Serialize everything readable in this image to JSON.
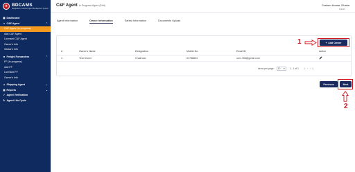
{
  "sidebar": {
    "logo": {
      "title": "BDCAMS",
      "subtitle": "Bangladesh Customs Agent Management System"
    },
    "items": [
      {
        "label": "Dashboard",
        "icon": "grid-icon"
      },
      {
        "label": "C&F Agent",
        "icon": "user-icon",
        "expandable": true
      },
      {
        "label": "C&F Agent (In progress)",
        "active": true
      },
      {
        "label": "Add C&F Agent"
      },
      {
        "label": "Licensed C&F Agent"
      },
      {
        "label": "Owner's Info"
      },
      {
        "label": "Sarkar's Info"
      },
      {
        "label": "Freight Forwarders",
        "icon": "truck-icon",
        "expandable": true
      },
      {
        "label": "FF (In progress)"
      },
      {
        "label": "Add FF"
      },
      {
        "label": "Licensed FF"
      },
      {
        "label": "Owner's Info"
      },
      {
        "label": "Shipping Agent",
        "icon": "ship-icon",
        "expandable": true
      },
      {
        "label": "Reports",
        "icon": "report-icon",
        "expandable": true
      },
      {
        "label": "Agent Verification",
        "icon": "check-icon"
      },
      {
        "label": "Agent Life Cycle",
        "icon": "cycle-icon"
      }
    ]
  },
  "header": {
    "title": "C&F Agent",
    "subtitle": "In Progress Agent (Edit)",
    "user_name": "Custom House, Dhaka",
    "user_role": "Initiator"
  },
  "tabs": [
    {
      "label": "Agent Information",
      "active": false
    },
    {
      "label": "Owner Information",
      "active": true
    },
    {
      "label": "Sarkar Information",
      "active": false
    },
    {
      "label": "Documents Upload",
      "active": false
    }
  ],
  "add_owner_label": "Add Owner",
  "table": {
    "columns": [
      "#",
      "Owner's Name",
      "Designation",
      "Mobile No",
      "Email ID",
      "Action"
    ],
    "rows": [
      {
        "idx": "1",
        "name": "Test Owner",
        "designation": "Chairman",
        "mobile": "01788804",
        "email": "own-788@gmail.com"
      }
    ]
  },
  "pagination": {
    "items_per_page_label": "Items per page:",
    "items_per_page": "10",
    "range": "1 - 1 of 1"
  },
  "buttons": {
    "previous": "Previous",
    "next": "Next"
  },
  "annotations": {
    "marker1": "1",
    "marker2": "2"
  },
  "colors": {
    "sidebar_bg": "#0f2a5e",
    "active_item": "#f39a1e",
    "primary_button": "#1b2a5e",
    "highlight": "#d0161e"
  }
}
